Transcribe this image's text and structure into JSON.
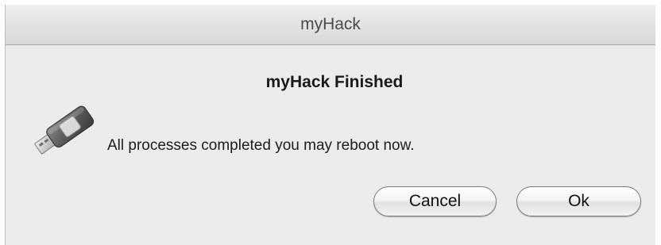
{
  "window": {
    "title": "myHack"
  },
  "dialog": {
    "heading": "myHack Finished",
    "message": "All processes completed you may reboot now.",
    "icon": "usb-drive-icon"
  },
  "buttons": {
    "cancel_label": "Cancel",
    "ok_label": "Ok"
  }
}
